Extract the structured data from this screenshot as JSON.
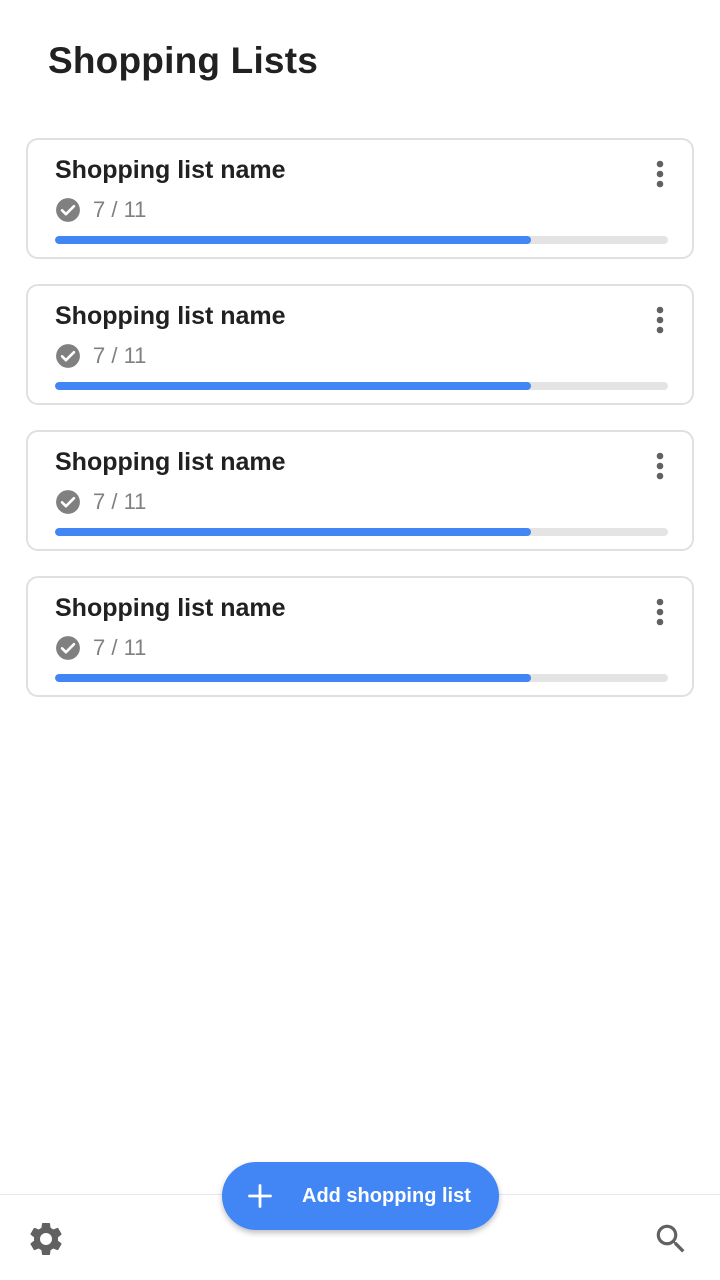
{
  "header": {
    "title": "Shopping Lists"
  },
  "lists": [
    {
      "name": "Shopping list name",
      "count_text": "7 / 11",
      "progress": 0.7765
    },
    {
      "name": "Shopping list name",
      "count_text": "7 / 11",
      "progress": 0.7765
    },
    {
      "name": "Shopping list name",
      "count_text": "7 / 11",
      "progress": 0.7765
    },
    {
      "name": "Shopping list name",
      "count_text": "7 / 11",
      "progress": 0.7765
    }
  ],
  "fab": {
    "label": "Add shopping list",
    "icon": "plus-icon"
  },
  "bottom_bar": {
    "left_icon": "gear-icon",
    "right_icon": "search-icon"
  },
  "colors": {
    "accent": "#4285f4",
    "track": "#e4e4e4",
    "muted": "#808080",
    "text": "#212121",
    "card_border": "#e0e0e0"
  }
}
